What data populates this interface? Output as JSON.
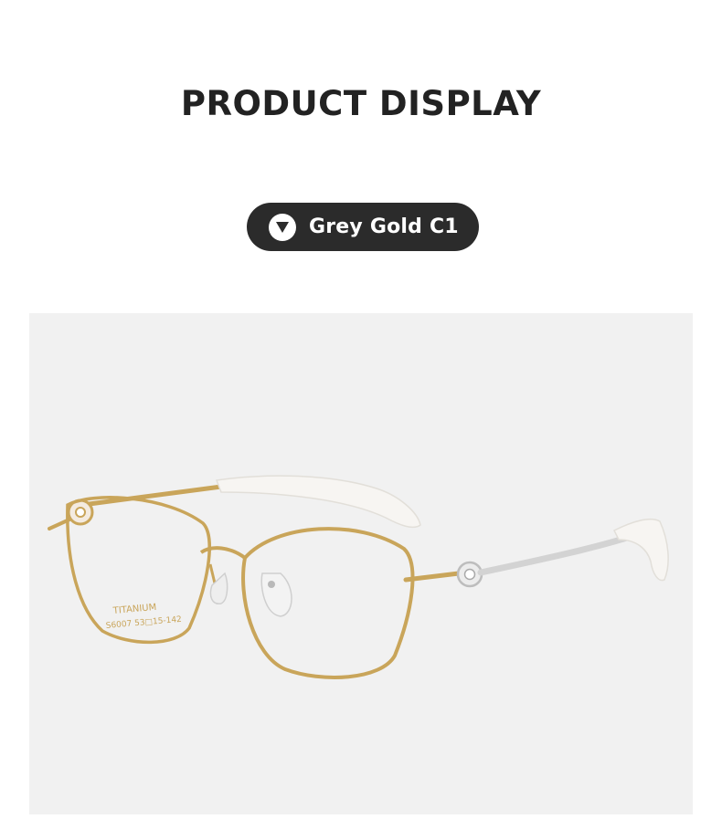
{
  "header": {
    "title": "PRODUCT DISPLAY"
  },
  "color_option": {
    "label": "Grey Gold C1",
    "icon": "triangle-down-icon"
  },
  "product_photo": {
    "subject": "titanium eyeglasses frame",
    "temple_print_line1": "TITANIUM",
    "temple_print_line2": "S6007 53□15-142"
  },
  "colors": {
    "title": "#222222",
    "pill_background": "#2b2b2b",
    "photo_background": "#f1f1f1",
    "frame_gold": "#c9a55a",
    "temple_silver": "#d3d3d3"
  }
}
